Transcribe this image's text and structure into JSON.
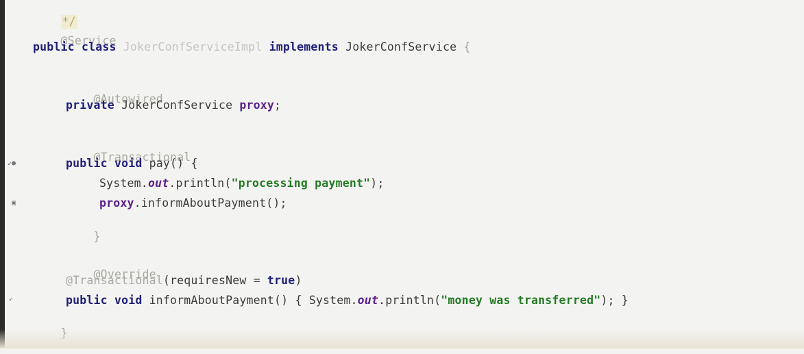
{
  "editor": {
    "gutter": {
      "markers": [
        "↙●",
        "▣",
        "↙"
      ]
    },
    "lines": {
      "comment_end": "*/",
      "service_annotation": "@Service",
      "class_decl": {
        "public": "public",
        "class": "class",
        "name": "JokerConfServiceImpl",
        "implements": "implements",
        "iface": "JokerConfService",
        "open": "{"
      },
      "autowired": "@Autowired",
      "field_decl": {
        "private": "private",
        "type": "JokerConfService",
        "name": "proxy",
        "semi": ";"
      },
      "transactional1": "@Transactional",
      "pay_decl": {
        "public": "public",
        "void": "void",
        "rest": "pay() {"
      },
      "println1": {
        "prefix": "System.",
        "out": "out",
        "call": ".println(",
        "str": "\"processing payment\"",
        "end": ");"
      },
      "proxy_call": {
        "obj": "proxy",
        "rest": ".informAboutPayment();"
      },
      "close_pay": "}",
      "override": "@Override",
      "transactional2": {
        "ann": "@Transactional",
        "args": "(requiresNew = ",
        "true": "true",
        "close": ")"
      },
      "inform_decl": {
        "public": "public",
        "void": "void",
        "rest": "informAboutPayment() { System.",
        "out": "out",
        "call": ".println(",
        "str": "\"money was transferred\"",
        "end": "); }"
      },
      "close_class": "}"
    }
  }
}
